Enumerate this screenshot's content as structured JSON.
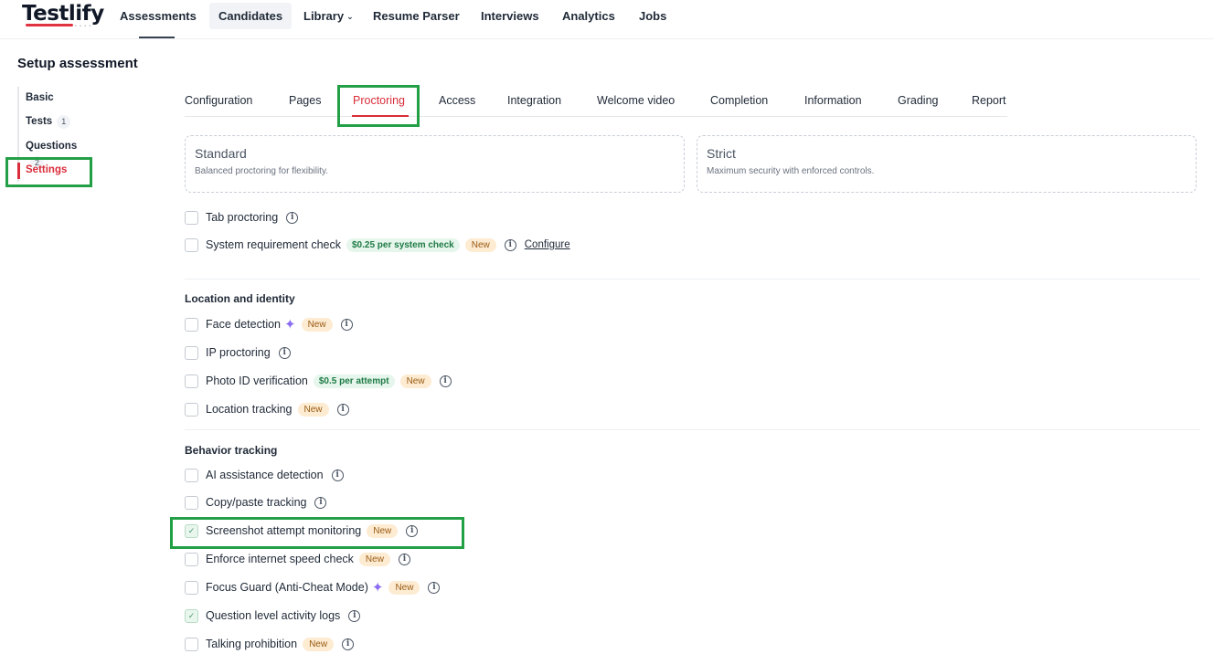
{
  "app": {
    "logo": "Testlify",
    "logo_dots": "• • • •"
  },
  "nav": {
    "assessments": "Assessments",
    "candidates": "Candidates",
    "library": "Library",
    "resume_parser": "Resume Parser",
    "interviews": "Interviews",
    "analytics": "Analytics",
    "jobs": "Jobs"
  },
  "page": {
    "title": "Setup assessment"
  },
  "steps": {
    "basic": "Basic",
    "tests": "Tests",
    "tests_count": "1",
    "questions": "Questions",
    "questions_count": "2",
    "settings": "Settings"
  },
  "tabs": {
    "configuration": "Configuration",
    "pages": "Pages",
    "proctoring": "Proctoring",
    "access": "Access",
    "integration": "Integration",
    "welcome_video": "Welcome video",
    "completion": "Completion",
    "information": "Information",
    "grading": "Grading",
    "report": "Report"
  },
  "modes": {
    "standard": {
      "title": "Standard",
      "desc": "Balanced proctoring for flexibility."
    },
    "strict": {
      "title": "Strict",
      "desc": "Maximum security with enforced controls."
    }
  },
  "general": {
    "tab_proctoring": {
      "label": "Tab proctoring",
      "checked": false
    },
    "system_check": {
      "label": "System requirement check",
      "price": "$0.25 per system check",
      "badge": "New",
      "link": "Configure",
      "checked": false
    }
  },
  "location": {
    "title": "Location and identity",
    "face_detection": {
      "label": "Face detection",
      "badge": "New",
      "checked": false
    },
    "ip_proctoring": {
      "label": "IP proctoring",
      "checked": false
    },
    "photo_id": {
      "label": "Photo ID verification",
      "price": "$0.5 per attempt",
      "badge": "New",
      "checked": false
    },
    "location_tracking": {
      "label": "Location tracking",
      "badge": "New",
      "checked": false
    }
  },
  "behavior": {
    "title": "Behavior tracking",
    "ai_detection": {
      "label": "AI assistance detection",
      "checked": false
    },
    "copy_paste": {
      "label": "Copy/paste tracking",
      "checked": false
    },
    "screenshot": {
      "label": "Screenshot attempt monitoring",
      "badge": "New",
      "checked": true
    },
    "internet_speed": {
      "label": "Enforce internet speed check",
      "badge": "New",
      "checked": false
    },
    "focus_guard": {
      "label": "Focus Guard (Anti-Cheat Mode)",
      "badge": "New",
      "checked": false
    },
    "activity_logs": {
      "label": "Question level activity logs",
      "checked": true
    },
    "talking": {
      "label": "Talking prohibition",
      "badge": "New",
      "checked": false
    }
  },
  "icons": {
    "info": "info-icon",
    "sparkle": "sparkle-icon",
    "check": "checkmark-icon",
    "chevron": "chevron-down-icon"
  },
  "colors": {
    "accent": "#d92d3a",
    "highlight": "#23a046",
    "new_badge_bg": "#fdebd2",
    "price_badge_bg": "#e6f6ec"
  }
}
